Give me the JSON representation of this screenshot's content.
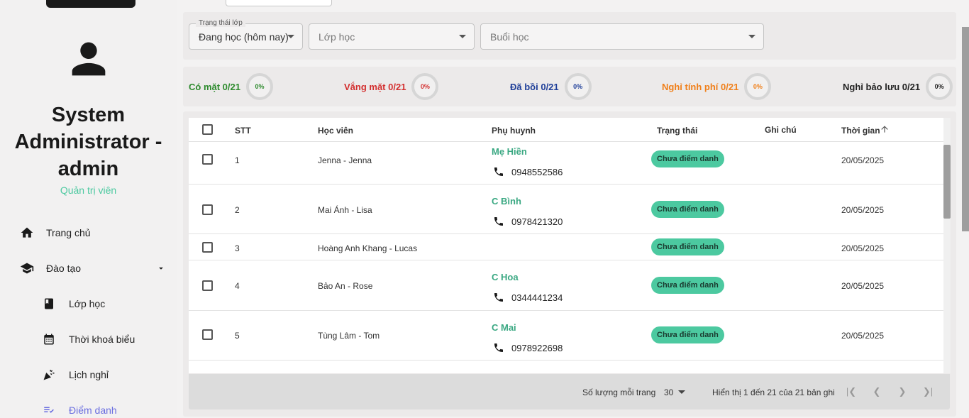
{
  "user": {
    "name": "System Administrator - admin",
    "role": "Quản trị viên"
  },
  "nav": {
    "home": "Trang chủ",
    "training": "Đào tạo",
    "classes": "Lớp học",
    "timetable": "Thời khoá biểu",
    "leave": "Lịch nghỉ",
    "attendance": "Điểm danh"
  },
  "filters": {
    "status_label": "Trạng thái lớp",
    "status_value": "Đang học (hôm nay)",
    "class_placeholder": "Lớp học",
    "session_placeholder": "Buổi học"
  },
  "stats": [
    {
      "label": "Có mặt 0/21",
      "pct": "0%",
      "color": "#2e8b2e"
    },
    {
      "label": "Vắng mặt 0/21",
      "pct": "0%",
      "color": "#d32f2f"
    },
    {
      "label": "Đã bồi 0/21",
      "pct": "0%",
      "color": "#1f3f99"
    },
    {
      "label": "Nghỉ tính phí 0/21",
      "pct": "0%",
      "color": "#f07f19"
    },
    {
      "label": "Nghỉ bảo lưu 0/21",
      "pct": "0%",
      "color": "#222222"
    }
  ],
  "table": {
    "headers": {
      "stt": "STT",
      "student": "Học viên",
      "parent": "Phụ huynh",
      "status": "Trạng thái",
      "note": "Ghi chú",
      "time": "Thời gian"
    },
    "rows": [
      {
        "stt": "1",
        "student": "Jenna - Jenna",
        "parent": "Mẹ Hiền",
        "phone": "0948552586",
        "status": "Chưa điểm danh",
        "time": "20/05/2025"
      },
      {
        "stt": "2",
        "student": "Mai Ánh - Lisa",
        "parent": "C Bình",
        "phone": "0978421320",
        "status": "Chưa điểm danh",
        "time": "20/05/2025"
      },
      {
        "stt": "3",
        "student": "Hoàng Anh Khang - Lucas",
        "parent": "",
        "phone": "",
        "status": "Chưa điểm danh",
        "time": "20/05/2025"
      },
      {
        "stt": "4",
        "student": "Bảo An - Rose",
        "parent": "C Hoa",
        "phone": "0344441234",
        "status": "Chưa điểm danh",
        "time": "20/05/2025"
      },
      {
        "stt": "5",
        "student": "Tùng Lâm - Tom",
        "parent": "C Mai",
        "phone": "0978922698",
        "status": "Chưa điểm danh",
        "time": "20/05/2025"
      }
    ]
  },
  "pagination": {
    "per_page_label": "Số lượng mỗi trang",
    "per_page_value": "30",
    "range": "Hiển thị 1 đến 21 của 21 bản ghi"
  },
  "icons": [
    "person-icon",
    "home-icon",
    "graduation-cap-icon",
    "chevron-down-icon",
    "book-icon",
    "calendar-icon",
    "party-popper-icon",
    "checklist-icon",
    "phone-icon",
    "arrow-up-icon",
    "first-page-icon",
    "prev-page-icon",
    "next-page-icon",
    "last-page-icon"
  ],
  "colors": {
    "accent": "#4cc9a0",
    "active_nav": "#6a6ee0"
  }
}
